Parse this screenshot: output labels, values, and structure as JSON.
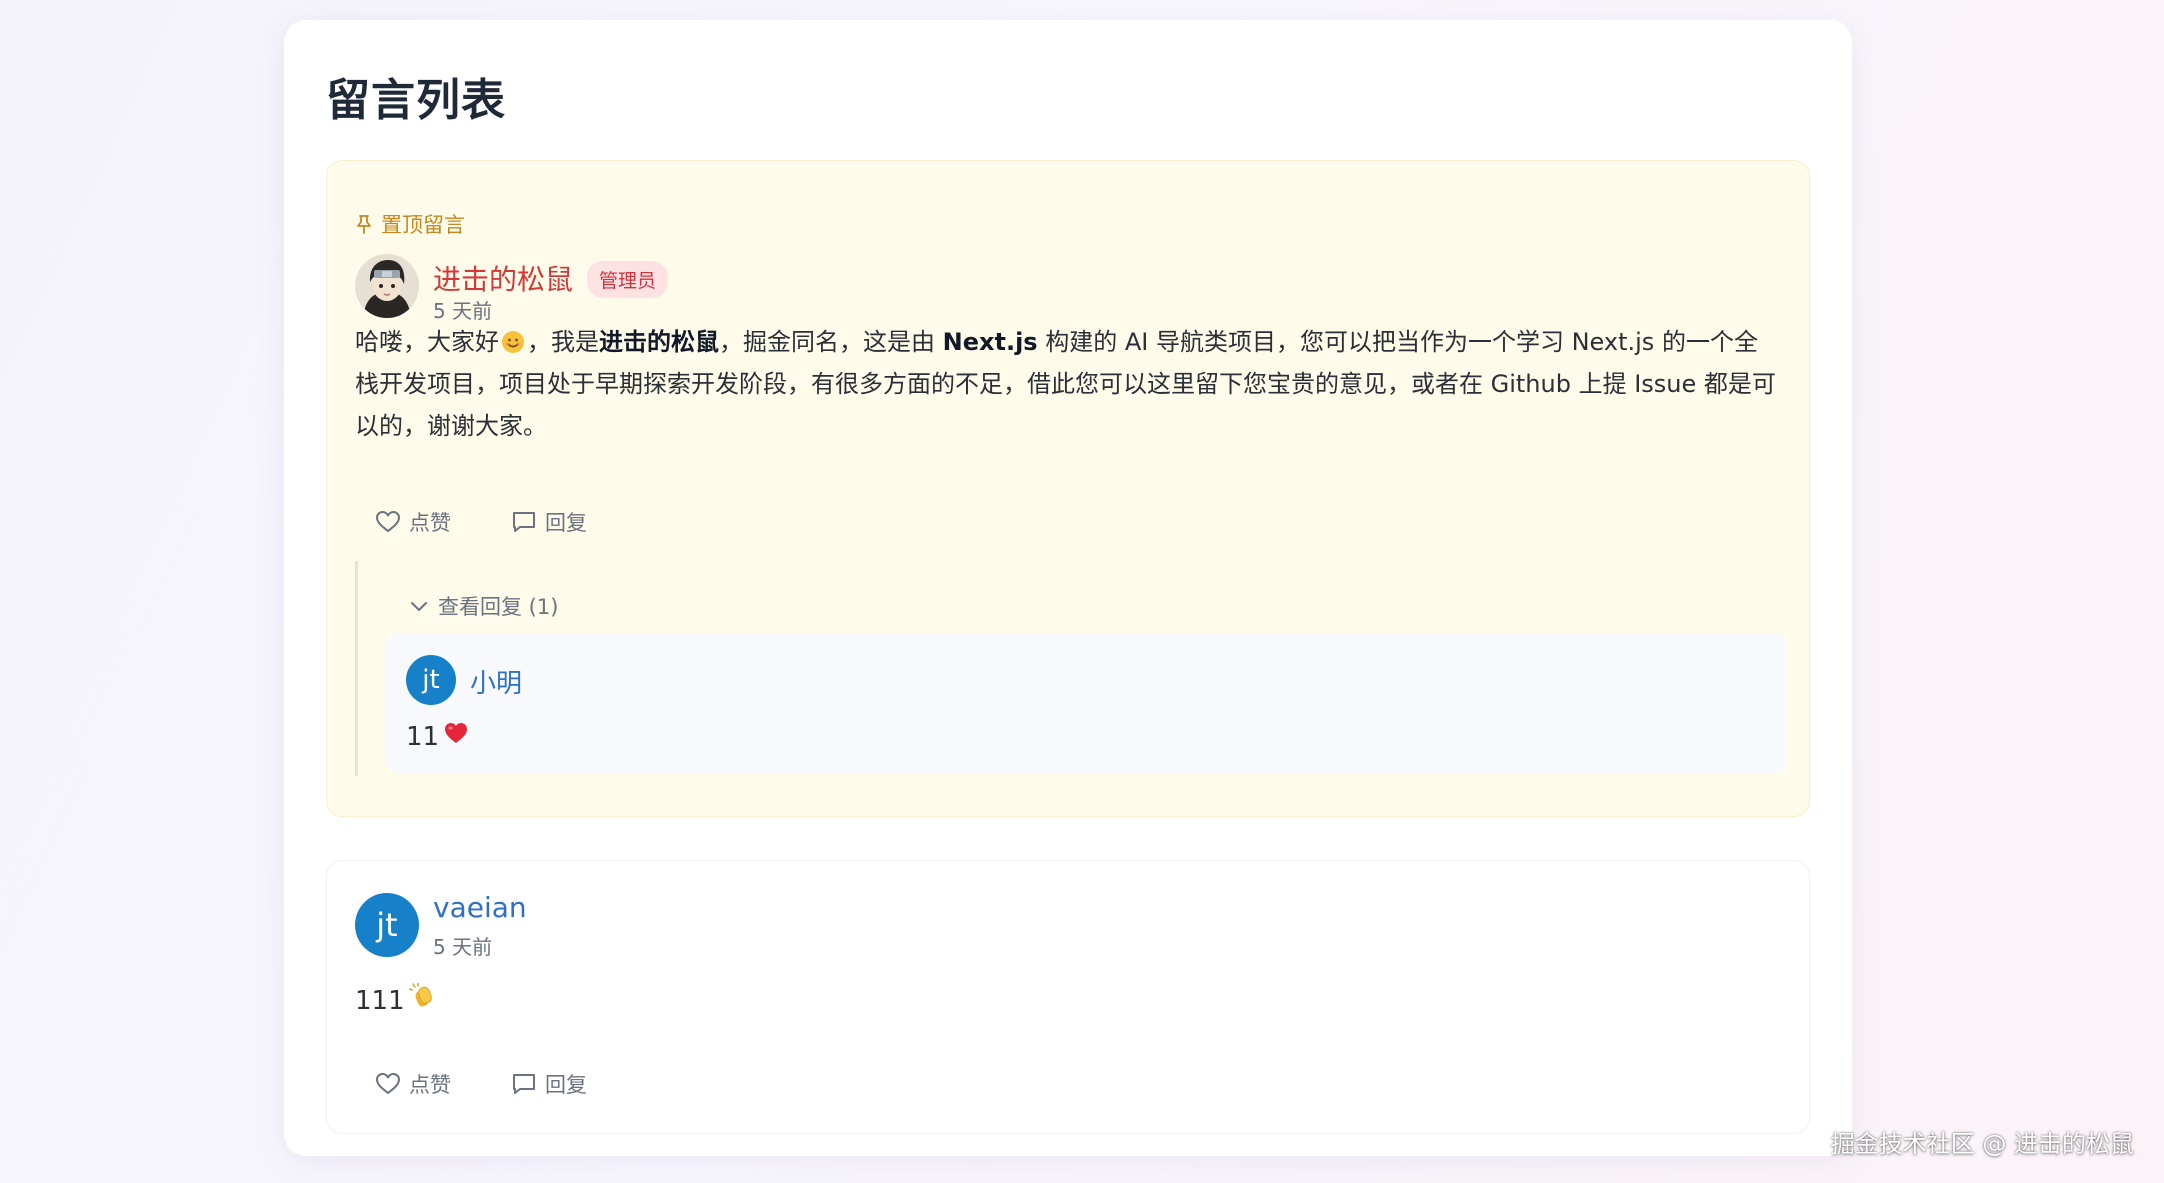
{
  "page_title": "留言列表",
  "pinned_comment": {
    "pin_label": "置顶留言",
    "author": "进击的松鼠",
    "badge": "管理员",
    "time": "5 天前",
    "content": {
      "p1": "哈喽，大家好",
      "p2": "，我是",
      "b1": "进击的松鼠",
      "p3": "，掘金同名，这是由 ",
      "b2": "Next.js",
      "p4": " 构建的 AI 导航类项目，您可以把当作为一个学习 Next.js 的一个全栈开发项目，项目处于早期探索开发阶段，有很多方面的不足，借此您可以这里留下您宝贵的意见，或者在 Github 上提 Issue 都是可以的，谢谢大家。"
    },
    "actions": {
      "like": "点赞",
      "reply": "回复"
    },
    "replies": {
      "toggle": "查看回复 (1)",
      "items": [
        {
          "avatar_letter": "jt",
          "author": "小明",
          "content": "11",
          "emoji": "heart"
        }
      ]
    }
  },
  "comments": [
    {
      "avatar_letter": "jt",
      "author": "vaeian",
      "time": "5 天前",
      "content": "111",
      "emoji": "clap",
      "actions": {
        "like": "点赞",
        "reply": "回复"
      }
    }
  ],
  "watermark": "掘金技术社区 @ 进击的松鼠",
  "colors": {
    "admin_name": "#d23a3a",
    "user_name": "#2f6fc4",
    "pinned_bg": "#fefbea",
    "pin_label": "#c8871f",
    "avatar_bg": "#1680c8"
  }
}
